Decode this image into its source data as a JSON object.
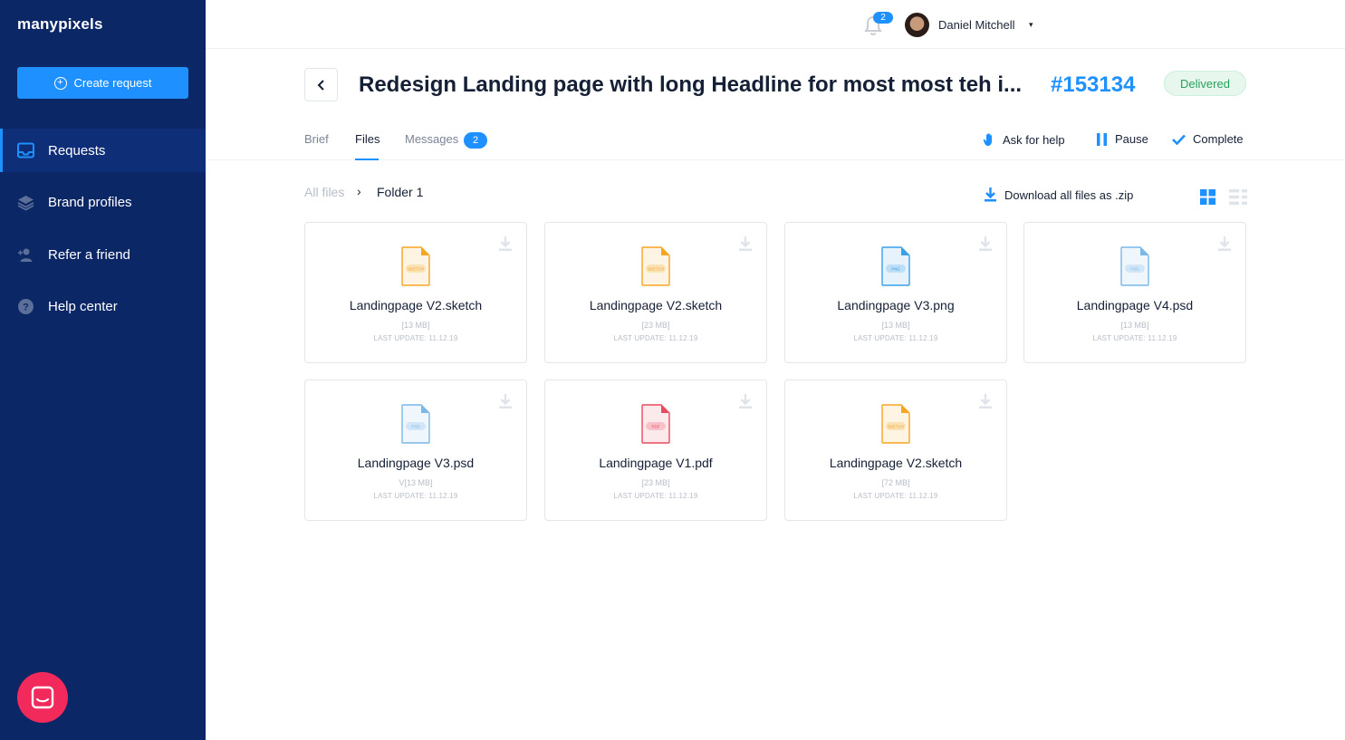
{
  "sidebar": {
    "logo": "manypixels",
    "create_label": "Create request",
    "items": [
      {
        "label": "Requests",
        "icon": "inbox-icon",
        "active": true
      },
      {
        "label": "Brand profiles",
        "icon": "layers-icon",
        "active": false
      },
      {
        "label": "Refer a friend",
        "icon": "user-plus-icon",
        "active": false
      },
      {
        "label": "Help center",
        "icon": "help-icon",
        "active": false
      }
    ],
    "chat_icon": "chat-icon"
  },
  "topbar": {
    "notification_count": "2",
    "user_name": "Daniel Mitchell",
    "caret": "▾"
  },
  "request": {
    "title": "Redesign Landing page with long Headline for most most teh i...",
    "id": "#153134",
    "status": "Delivered"
  },
  "tabs": {
    "brief": "Brief",
    "files": "Files",
    "messages": "Messages",
    "messages_count": "2"
  },
  "actions": {
    "ask_help": "Ask for help",
    "pause": "Pause",
    "complete": "Complete"
  },
  "breadcrumb": {
    "root": "All files",
    "separator": "›",
    "current": "Folder 1"
  },
  "download_all": "Download all files as .zip",
  "colors": {
    "sidebar": "#0b2765",
    "accent": "#1e90ff",
    "sketch": "#f5a623",
    "png": "#3aa0e8",
    "psd": "#7ab8e8",
    "pdf": "#e84a5f",
    "delivered": "#25a25a"
  },
  "files": [
    {
      "name": "Landingpage V2.sketch",
      "size": "[13 MB]",
      "updated": "LAST UPDATE: 11.12.19",
      "type": "SKETCH",
      "kind": "sketch"
    },
    {
      "name": "Landingpage V2.sketch",
      "size": "[23 MB]",
      "updated": "LAST UPDATE: 11.12.19",
      "type": "SKETCH",
      "kind": "sketch"
    },
    {
      "name": "Landingpage V3.png",
      "size": "[13 MB]",
      "updated": "LAST UPDATE: 11.12.19",
      "type": "PNG",
      "kind": "png"
    },
    {
      "name": "Landingpage V4.psd",
      "size": "[13 MB]",
      "updated": "LAST UPDATE: 11.12.19",
      "type": "PSD",
      "kind": "psd"
    },
    {
      "name": "Landingpage V3.psd",
      "size": "V[13 MB]",
      "updated": "LAST UPDATE: 11.12.19",
      "type": "PSD",
      "kind": "psd"
    },
    {
      "name": "Landingpage V1.pdf",
      "size": "[23 MB]",
      "updated": "LAST UPDATE: 11.12.19",
      "type": "PDF",
      "kind": "pdf"
    },
    {
      "name": "Landingpage V2.sketch",
      "size": "[72 MB]",
      "updated": "LAST UPDATE: 11.12.19",
      "type": "SKETCH",
      "kind": "sketch"
    }
  ]
}
